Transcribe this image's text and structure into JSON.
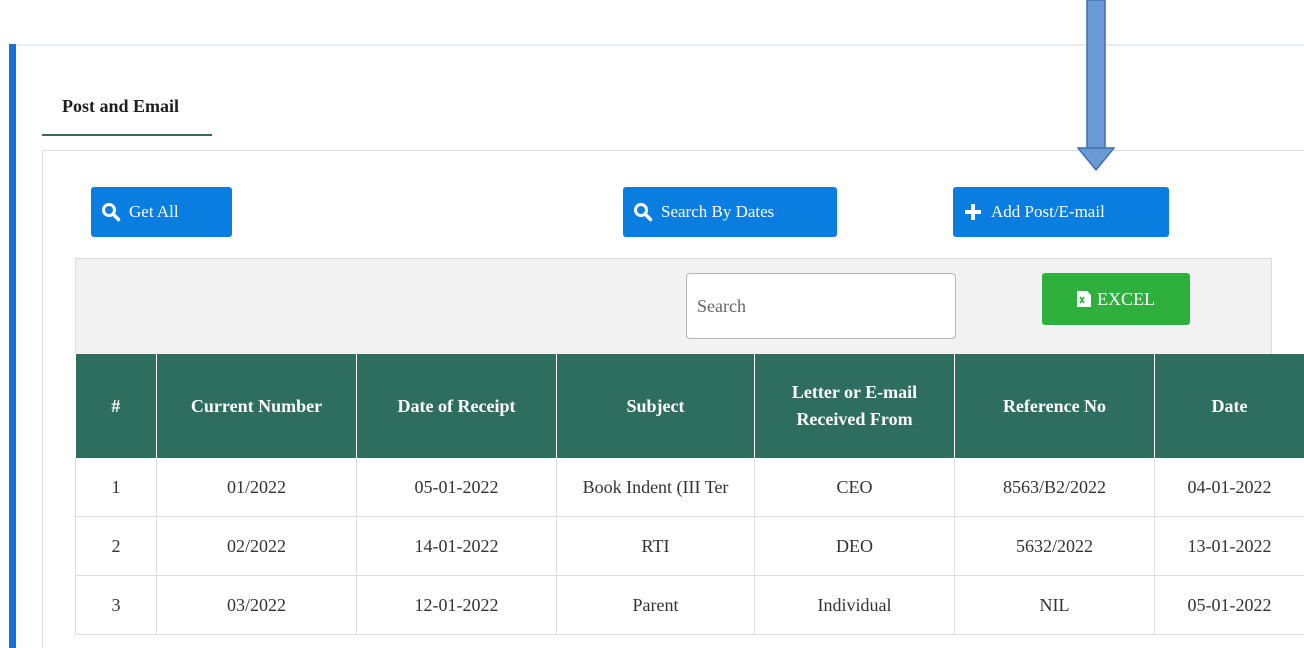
{
  "tab": {
    "label": "Post and Email"
  },
  "buttons": {
    "get_all": "Get All",
    "search_by_dates": "Search By Dates",
    "add_post": "Add Post/E-mail",
    "excel": "EXCEL"
  },
  "search": {
    "placeholder": "Search"
  },
  "icons": {
    "search": "search-icon",
    "plus": "plus-icon",
    "excel": "excel-file-icon",
    "arrow": "down-arrow-icon"
  },
  "colors": {
    "primary_button": "#0a7ee0",
    "excel_button": "#2fb03c",
    "table_header": "#2d6e5e",
    "accent_bar": "#1a6fe0",
    "arrow": "#6a9ad6"
  },
  "table": {
    "headers": [
      "#",
      "Current Number",
      "Date of Receipt",
      "Subject",
      "Letter or E-mail Received From",
      "Reference No",
      "Date"
    ],
    "rows": [
      [
        "1",
        "01/2022",
        "05-01-2022",
        "Book Indent (III Ter",
        "CEO",
        "8563/B2/2022",
        "04-01-2022"
      ],
      [
        "2",
        "02/2022",
        "14-01-2022",
        "RTI",
        "DEO",
        "5632/2022",
        "13-01-2022"
      ],
      [
        "3",
        "03/2022",
        "12-01-2022",
        "Parent",
        "Individual",
        "NIL",
        "05-01-2022"
      ]
    ]
  }
}
